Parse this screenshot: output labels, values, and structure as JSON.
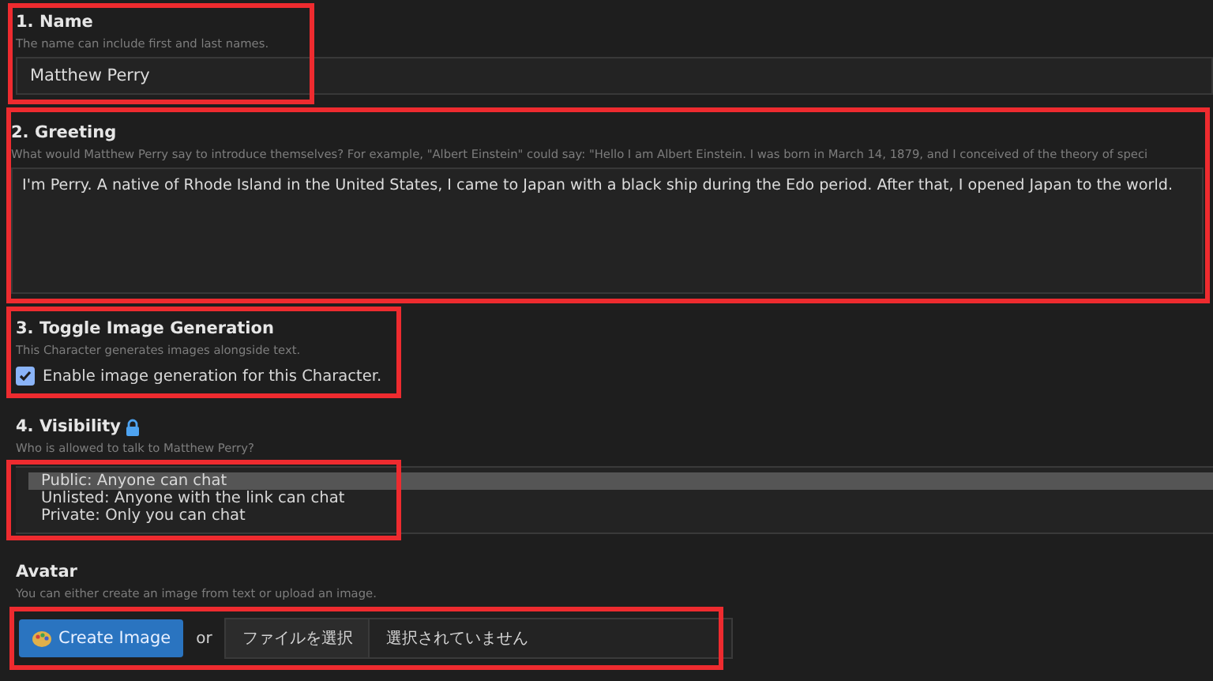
{
  "sections": [
    {
      "kind": "text",
      "title": "1. Name",
      "hint": "The name can include first and last names.",
      "value": "Matthew Perry",
      "highlighted": true
    },
    {
      "kind": "textarea",
      "title": "2. Greeting",
      "hint": "What would Matthew Perry say to introduce themselves? For example, \"Albert Einstein\" could say: \"Hello I am Albert Einstein. I was born in March 14, 1879, and I conceived of the theory of speci",
      "value": "I'm Perry. A native of Rhode Island in the United States, I came to Japan with a black ship during the Edo period. After that, I opened Japan to the world.",
      "highlighted": true
    },
    {
      "kind": "checkbox",
      "title": "3. Toggle Image Generation",
      "hint": "This Character generates images alongside text.",
      "label": "Enable image generation for this Character.",
      "checked": true,
      "highlighted": true
    },
    {
      "kind": "list",
      "title": "4. Visibility",
      "locked": true,
      "hint": "Who is allowed to talk to Matthew Perry?",
      "options": [
        {
          "label": "Public: Anyone can chat",
          "selected": true
        },
        {
          "label": "Unlisted: Anyone with the link can chat",
          "selected": false
        },
        {
          "label": "Private: Only you can chat",
          "selected": false
        }
      ],
      "highlighted": true
    },
    {
      "kind": "avatar",
      "title": "Avatar",
      "hint": "You can either create an image from text or upload an image.",
      "button": "Create Image",
      "or": "or",
      "file_button": "ファイルを選択",
      "file_status": "選択されていません",
      "highlighted": true
    }
  ]
}
